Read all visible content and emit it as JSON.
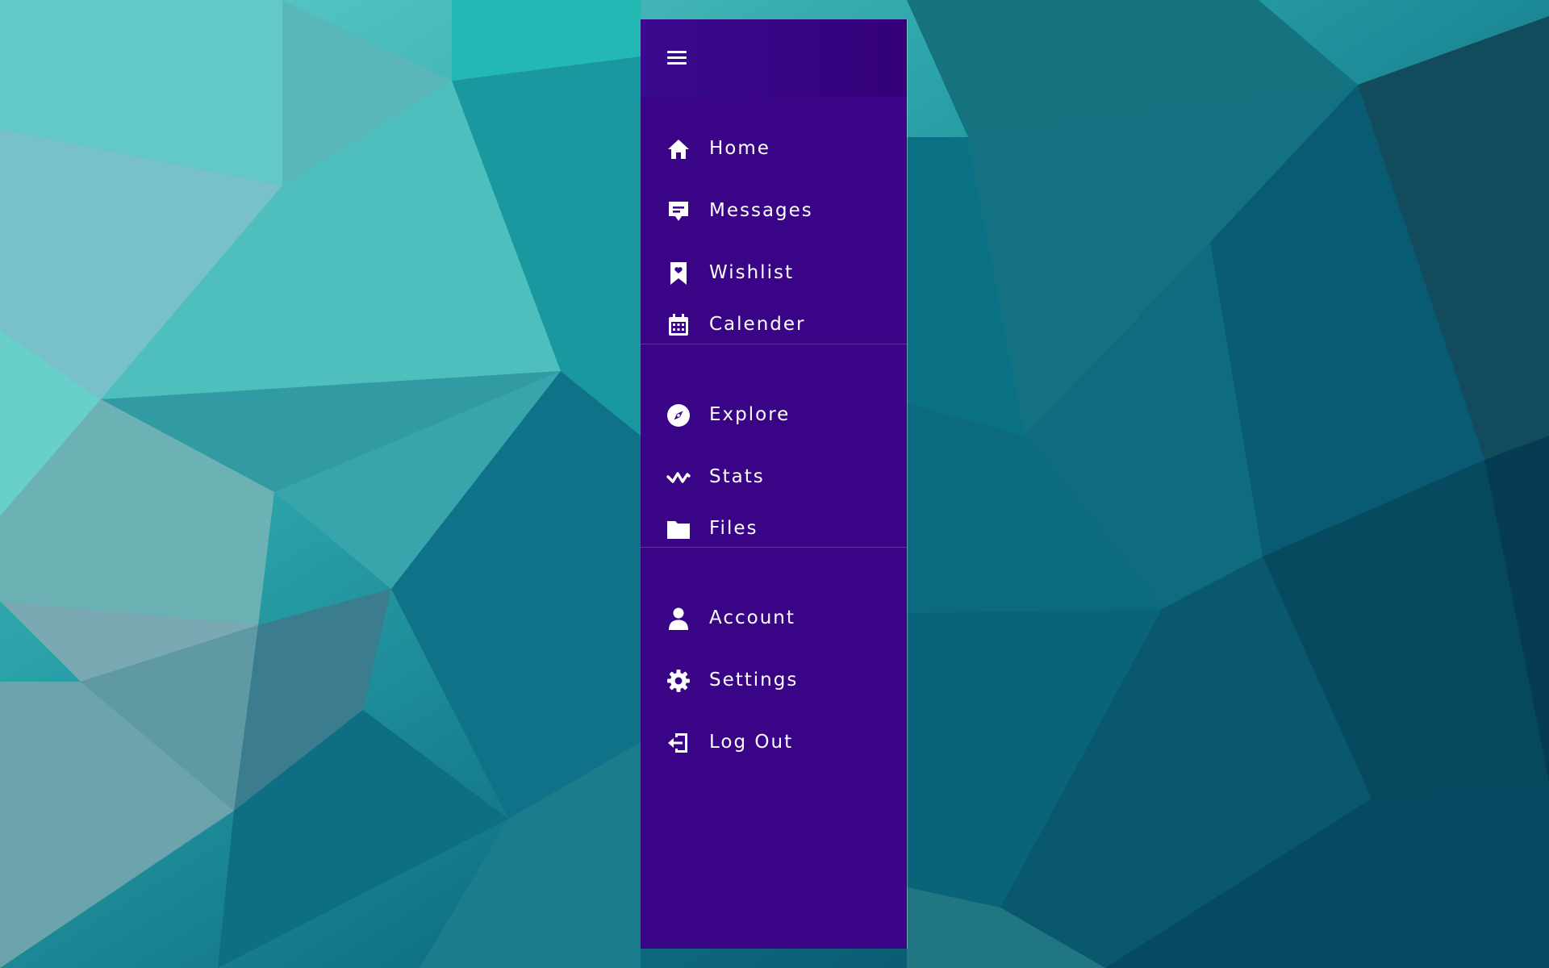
{
  "sidebar": {
    "menu_icon": "hamburger-menu-icon",
    "background_color": "#3a0486",
    "items": [
      {
        "label": "Home",
        "icon": "home-icon"
      },
      {
        "label": "Messages",
        "icon": "message-icon"
      },
      {
        "label": "Wishlist",
        "icon": "bookmark-heart-icon"
      },
      {
        "label": "Calender",
        "icon": "calendar-icon"
      },
      {
        "label": "Explore",
        "icon": "compass-icon"
      },
      {
        "label": "Stats",
        "icon": "activity-icon"
      },
      {
        "label": "Files",
        "icon": "folder-icon"
      },
      {
        "label": "Account",
        "icon": "user-icon"
      },
      {
        "label": "Settings",
        "icon": "gear-icon"
      },
      {
        "label": "Log Out",
        "icon": "logout-icon"
      }
    ]
  },
  "background": {
    "style": "low-poly teal gradient",
    "colors": [
      "#5cc9c6",
      "#1f8f99",
      "#0b5d73"
    ]
  }
}
